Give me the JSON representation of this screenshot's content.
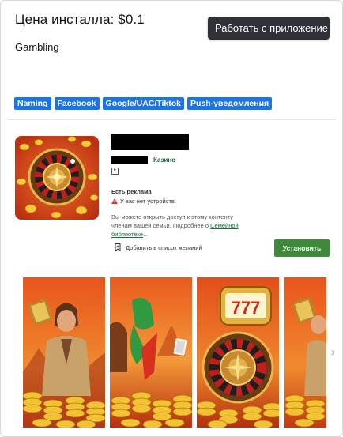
{
  "header": {
    "price_title": "Цена инсталла: $0.1",
    "work_button": "Работать с приложение",
    "category": "Gambling"
  },
  "tags": [
    "Naming",
    "Facebook",
    "Google/UAC/Tiktok",
    "Push-уведомления"
  ],
  "store": {
    "genre": "Казино",
    "rating_badge": "E",
    "ads_notice": "Есть реклама",
    "no_devices": "У вас нет устройств.",
    "family_text": "Вы можете открыть доступ к этому контенту членам вашей семьи. Подробнее о ",
    "family_link": "Семейной библиотеке",
    "family_tail": "...",
    "wishlist": "Добавить в список желаний",
    "install": "Установить"
  },
  "screenshots": [
    "bookofra-man",
    "pharaoh-777",
    "roulette-777",
    "bookofra-man-2"
  ],
  "colors": {
    "dark_button": "#2f3136",
    "tag_blue": "#1a73e8",
    "install_green": "#3c8a3a",
    "genre_green": "#2a6b35"
  }
}
